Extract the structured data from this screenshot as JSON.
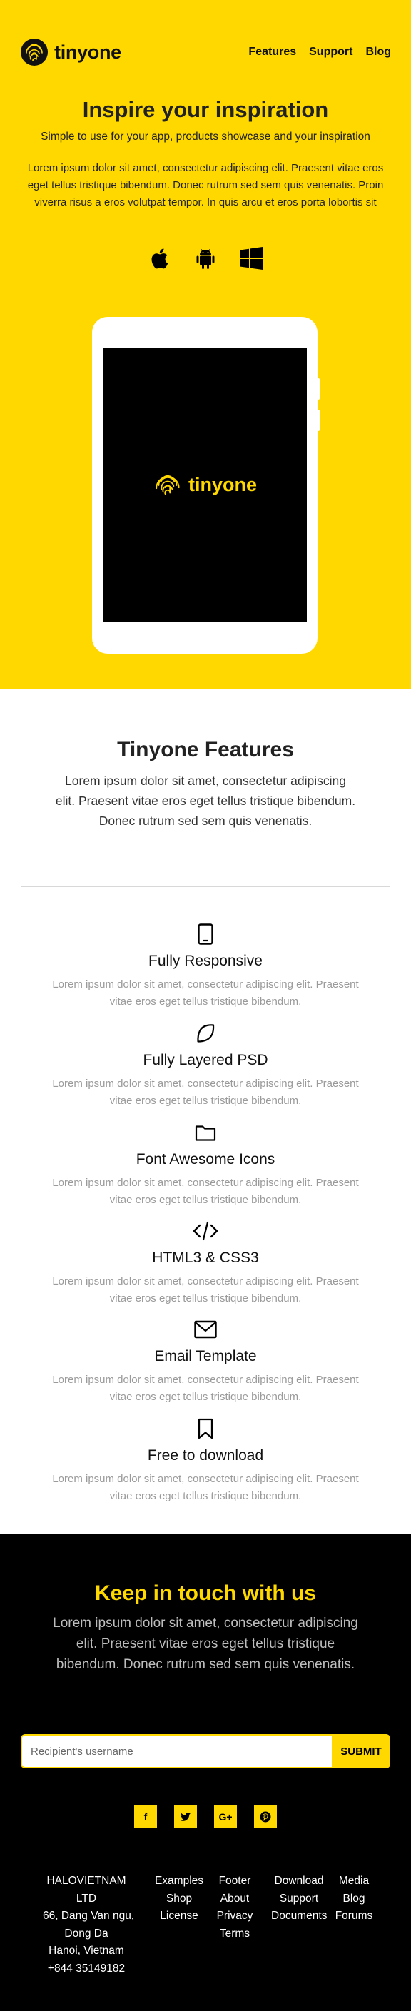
{
  "brand": {
    "name": "tinyone",
    "accent": "#ffd800"
  },
  "nav": {
    "items": [
      "Features",
      "Support",
      "Blog"
    ]
  },
  "hero": {
    "title": "Inspire your inspiration",
    "subtitle": "Simple to use for your app, products showcase and your inspiration",
    "paragraph": "Lorem ipsum dolor sit amet, consectetur adipiscing elit. Praesent vitae eros eget tellus tristique bibendum. Donec rutrum sed sem quis venenatis. Proin viverra risus a eros volutpat tempor. In quis arcu et eros porta lobortis sit",
    "platform_icons": [
      "apple-icon",
      "android-icon",
      "windows-icon"
    ]
  },
  "features": {
    "title": "Tinyone Features",
    "description": "Lorem ipsum dolor sit amet, consectetur adipiscing elit. Praesent vitae eros eget tellus tristique bibendum. Donec rutrum sed sem quis venenatis.",
    "items": [
      {
        "icon": "tablet-icon",
        "title": "Fully Responsive",
        "description": "Lorem ipsum dolor sit amet, consectetur adipiscing elit. Praesent vitae eros eget tellus tristique bibendum."
      },
      {
        "icon": "leaf-icon",
        "title": "Fully Layered PSD",
        "description": "Lorem ipsum dolor sit amet, consectetur adipiscing elit. Praesent vitae eros eget tellus tristique bibendum."
      },
      {
        "icon": "folder-icon",
        "title": "Font Awesome Icons",
        "description": "Lorem ipsum dolor sit amet, consectetur adipiscing elit. Praesent vitae eros eget tellus tristique bibendum."
      },
      {
        "icon": "code-icon",
        "title": "HTML3 & CSS3",
        "description": "Lorem ipsum dolor sit amet, consectetur adipiscing elit. Praesent vitae eros eget tellus tristique bibendum."
      },
      {
        "icon": "envelope-icon",
        "title": "Email Template",
        "description": "Lorem ipsum dolor sit amet, consectetur adipiscing elit. Praesent vitae eros eget tellus tristique bibendum."
      },
      {
        "icon": "bookmark-icon",
        "title": "Free to download",
        "description": "Lorem ipsum dolor sit amet, consectetur adipiscing elit. Praesent vitae eros eget tellus tristique bibendum."
      }
    ]
  },
  "contact": {
    "title": "Keep in touch with us",
    "description": "Lorem ipsum dolor sit amet, consectetur adipiscing elit. Praesent vitae eros eget tellus tristique bibendum. Donec rutrum sed sem quis venenatis.",
    "input_placeholder": "Recipient's username",
    "submit_label": "SUBMIT",
    "social": [
      {
        "icon": "facebook-icon",
        "label": "f"
      },
      {
        "icon": "twitter-icon",
        "label": ""
      },
      {
        "icon": "google-plus-icon",
        "label": "G+"
      },
      {
        "icon": "pinterest-icon",
        "label": ""
      }
    ]
  },
  "footer": {
    "address": [
      "HALOVIETNAM",
      "LTD",
      "66, Dang Van ngu,",
      "Dong Da",
      "Hanoi, Vietnam",
      "+844 35149182"
    ],
    "col1": [
      "Examples",
      "Shop",
      "License"
    ],
    "col2": [
      "Footer",
      "About",
      "Privacy",
      "Terms"
    ],
    "col3": [
      "Download",
      "Support",
      "Documents"
    ],
    "col4": [
      "Media",
      "Blog",
      "Forums"
    ]
  }
}
